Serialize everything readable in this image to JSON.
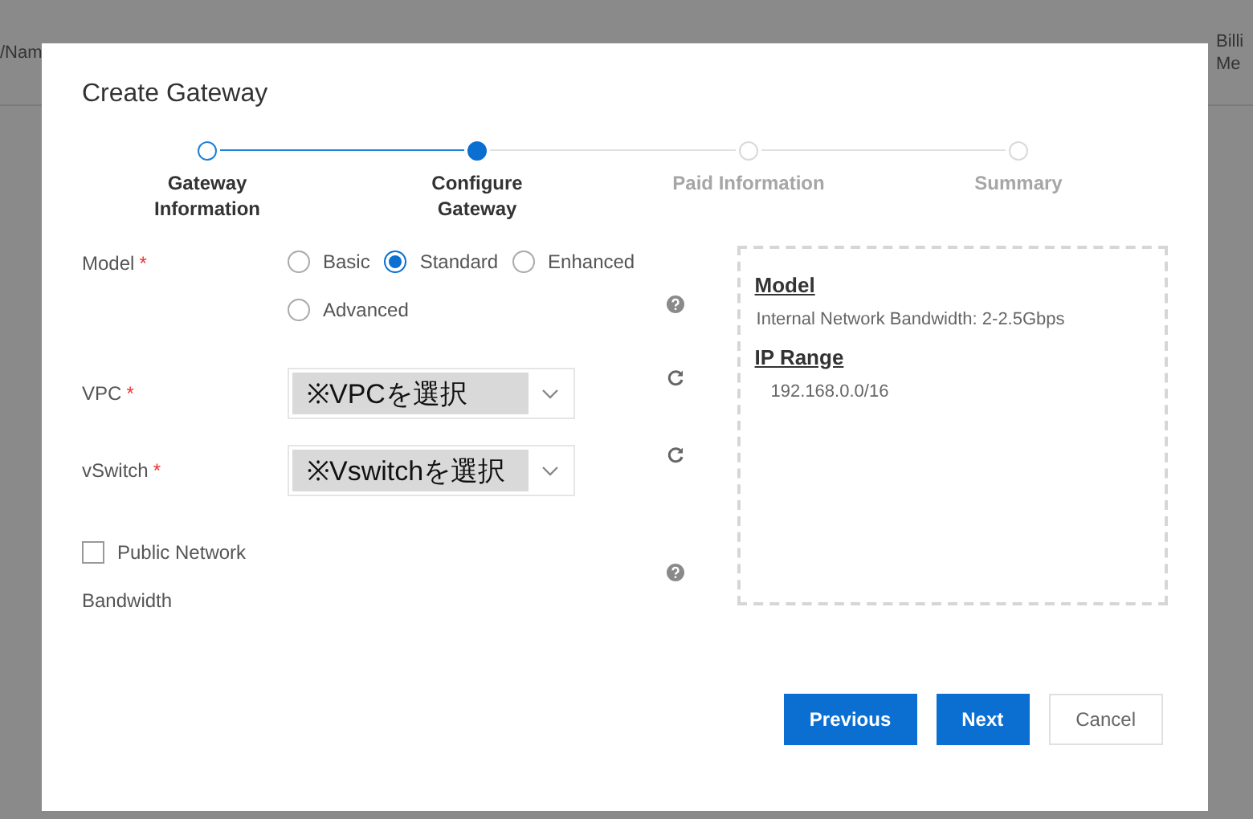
{
  "background_table": {
    "headers": [
      {
        "text": "/Nam"
      },
      {
        "text": "Billi\nMe"
      }
    ]
  },
  "dialog": {
    "title": "Create Gateway",
    "steps": [
      {
        "label": "Gateway Information",
        "completed": true,
        "selected": false
      },
      {
        "label": "Configure Gateway",
        "completed": false,
        "selected": true
      },
      {
        "label": "Paid Information",
        "completed": false,
        "selected": false
      },
      {
        "label": "Summary",
        "completed": false,
        "selected": false
      }
    ],
    "model": {
      "label": "Model",
      "required_mark": "*",
      "options": [
        {
          "label": "Basic",
          "selected": false
        },
        {
          "label": "Standard",
          "selected": true
        },
        {
          "label": "Enhanced",
          "selected": false
        },
        {
          "label": "Advanced",
          "selected": false
        }
      ]
    },
    "vpc": {
      "label": "VPC",
      "required_mark": "*",
      "value": "※VPCを選択"
    },
    "vswitch": {
      "label": "vSwitch",
      "required_mark": "*",
      "value": "※Vswitchを選択"
    },
    "public_network": {
      "label": "Public Network",
      "checked": false
    },
    "bandwidth": {
      "label": "Bandwidth"
    },
    "summary": [
      {
        "heading": "Model",
        "value": "Internal Network Bandwidth: 2-2.5Gbps"
      },
      {
        "heading": "IP Range",
        "value": "192.168.0.0/16"
      }
    ],
    "buttons": [
      {
        "label": "Previous",
        "kind": "primary"
      },
      {
        "label": "Next",
        "kind": "primary"
      },
      {
        "label": "Cancel",
        "kind": "secondary"
      }
    ]
  }
}
